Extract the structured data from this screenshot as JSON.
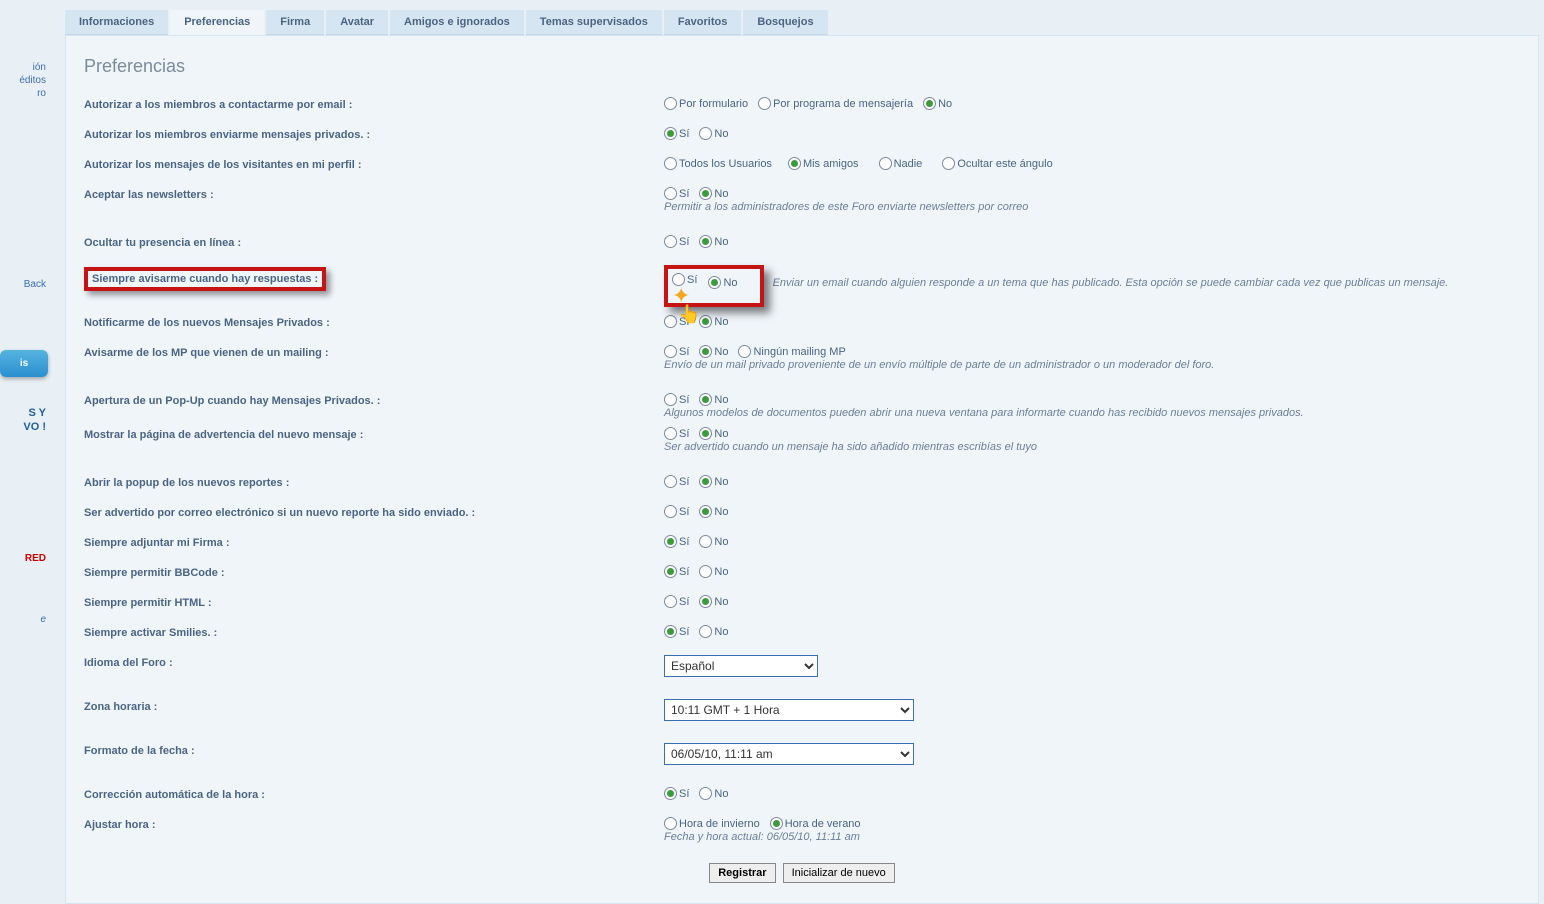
{
  "sidebar": {
    "links": [
      "ión",
      "éditos",
      "ro"
    ],
    "back": "Back",
    "blue_btn": "is",
    "promo1": "S Y",
    "promo2": "VO !",
    "red": "RED",
    "dark": "e"
  },
  "tabs": [
    "Informaciones",
    "Preferencias",
    "Firma",
    "Avatar",
    "Amigos e ignorados",
    "Temas supervisados",
    "Favoritos",
    "Bosquejos"
  ],
  "panel_title": "Preferencias",
  "opts": {
    "por_formulario": "Por formulario",
    "por_programa": "Por programa de mensajería",
    "si": "Sí",
    "no": "No",
    "todos": "Todos los Usuarios",
    "amigos": "Mis amigos",
    "nadie": "Nadie",
    "ocultar": "Ocultar este ángulo",
    "ningun": "Ningún mailing MP",
    "invierno": "Hora de invierno",
    "verano": "Hora de verano"
  },
  "rows": {
    "r1": "Autorizar a los miembros a contactarme por email :",
    "r2": "Autorizar los miembros enviarme mensajes privados. :",
    "r3": "Autorizar los mensajes de los visitantes en mi perfil :",
    "r4": "Aceptar las newsletters :",
    "r4_hint": "Permitir a los administradores de este Foro enviarte newsletters por correo",
    "r5": "Ocultar tu presencia en línea :",
    "r6": "Siempre avisarme cuando hay respuestas :",
    "r6_hint": "Enviar un email cuando alguien responde a un tema que has publicado. Esta opción se puede cambiar cada vez que publicas un mensaje.",
    "r7": "Notificarme de los nuevos Mensajes Privados :",
    "r8": "Avisarme de los MP que vienen de un mailing :",
    "r8_hint": "Envío de un mail privado proveniente de un envío múltiple de parte de un administrador o un moderador del foro.",
    "r9": "Apertura de un Pop-Up cuando hay Mensajes Privados. :",
    "r9_hint": "Algunos modelos de documentos pueden abrir una nueva ventana para informarte cuando has recibido nuevos mensajes privados.",
    "r10": "Mostrar la página de advertencia del nuevo mensaje :",
    "r10_hint": "Ser advertido cuando un mensaje ha sido añadido mientras escribías el tuyo",
    "r11": "Abrir la popup de los nuevos reportes :",
    "r12": "Ser advertido por correo electrónico si un nuevo reporte ha sido enviado. :",
    "r13": "Siempre adjuntar mi Firma :",
    "r14": "Siempre permitir BBCode :",
    "r15": "Siempre permitir HTML :",
    "r16": "Siempre activar Smilies. :",
    "r17": "Idioma del Foro :",
    "r18": "Zona horaria :",
    "r19": "Formato de la fecha :",
    "r20": "Corrección automática de la hora :",
    "r21": "Ajustar hora :",
    "r21_hint": "Fecha y hora actual: 06/05/10, 11:11 am"
  },
  "selects": {
    "lang": "Español",
    "tz": "10:11 GMT + 1 Hora",
    "date": "06/05/10, 11:11 am"
  },
  "buttons": {
    "save": "Registrar",
    "reset": "Inicializar de nuevo"
  }
}
